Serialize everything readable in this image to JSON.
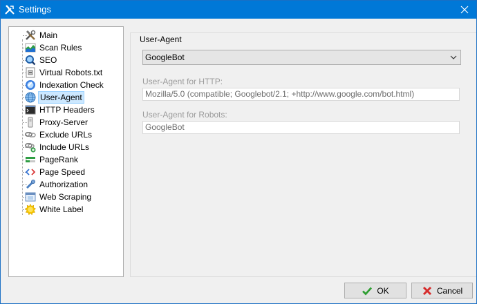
{
  "window": {
    "title": "Settings",
    "close_glyph": "✕"
  },
  "tree": {
    "items": [
      {
        "label": "Main",
        "icon": "tools-icon"
      },
      {
        "label": "Scan Rules",
        "icon": "chart-icon"
      },
      {
        "label": "SEO",
        "icon": "magnifier-icon"
      },
      {
        "label": "Virtual Robots.txt",
        "icon": "robots-file-icon"
      },
      {
        "label": "Indexation Check",
        "icon": "index-check-icon"
      },
      {
        "label": "User-Agent",
        "icon": "globe-icon",
        "selected": true
      },
      {
        "label": "HTTP Headers",
        "icon": "terminal-icon"
      },
      {
        "label": "Proxy-Server",
        "icon": "server-icon"
      },
      {
        "label": "Exclude URLs",
        "icon": "link-remove-icon"
      },
      {
        "label": "Include URLs",
        "icon": "link-add-icon"
      },
      {
        "label": "PageRank",
        "icon": "pagerank-icon"
      },
      {
        "label": "Page Speed",
        "icon": "code-icon"
      },
      {
        "label": "Authorization",
        "icon": "key-icon"
      },
      {
        "label": "Web Scraping",
        "icon": "web-scraping-icon"
      },
      {
        "label": "White Label",
        "icon": "sun-icon"
      }
    ]
  },
  "panel": {
    "group_title": "User-Agent",
    "agent_select": {
      "value": "GoogleBot"
    },
    "http_agent": {
      "label": "User-Agent for HTTP:",
      "value": "Mozilla/5.0 (compatible; Googlebot/2.1; +http://www.google.com/bot.html)"
    },
    "robots_agent": {
      "label": "User-Agent for Robots:",
      "value": "GoogleBot"
    }
  },
  "buttons": {
    "ok": "OK",
    "cancel": "Cancel"
  },
  "colors": {
    "titlebar": "#0078d7",
    "selection": "#cce8ff",
    "ok_check": "#2e9e32",
    "cancel_x": "#d62b2b"
  }
}
